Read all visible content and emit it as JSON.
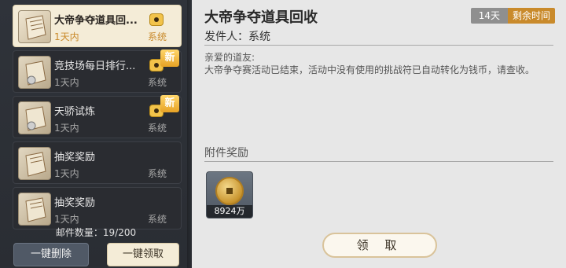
{
  "mail_list": [
    {
      "title": "大帝争夺道具回...",
      "time": "1天内",
      "sender": "系统",
      "active": true,
      "has_attachment": true,
      "is_new": false
    },
    {
      "title": "竞技场每日排行...",
      "time": "1天内",
      "sender": "系统",
      "active": false,
      "has_attachment": true,
      "is_new": true,
      "new_label": "新"
    },
    {
      "title": "天骄试炼",
      "time": "1天内",
      "sender": "系统",
      "active": false,
      "has_attachment": true,
      "is_new": true,
      "new_label": "新"
    },
    {
      "title": "抽奖奖励",
      "time": "1天内",
      "sender": "系统",
      "active": false,
      "has_attachment": false,
      "is_new": false
    },
    {
      "title": "抽奖奖励",
      "time": "1天内",
      "sender": "系统",
      "active": false,
      "has_attachment": false,
      "is_new": false
    }
  ],
  "mail_count": "邮件数量：19/200",
  "buttons": {
    "delete_all": "一键删除",
    "claim_all": "一键领取",
    "claim": "领 取"
  },
  "detail": {
    "title": "大帝争夺道具回收",
    "days": "14天",
    "remain_label": "剩余时间",
    "from": "发件人：系统",
    "greeting": "亲爱的道友:",
    "body": "大帝争夺赛活动已结束，活动中没有使用的挑战符已自动转化为钱币，请查收。",
    "attachment_label": "附件奖励",
    "attachment": {
      "icon": "coin-icon",
      "quantity": "8924万"
    }
  },
  "colors": {
    "accent": "#c98a2b",
    "panel_dark": "#2f333a",
    "panel_light": "#e7e7e7",
    "active_item": "#f4ecd7"
  }
}
